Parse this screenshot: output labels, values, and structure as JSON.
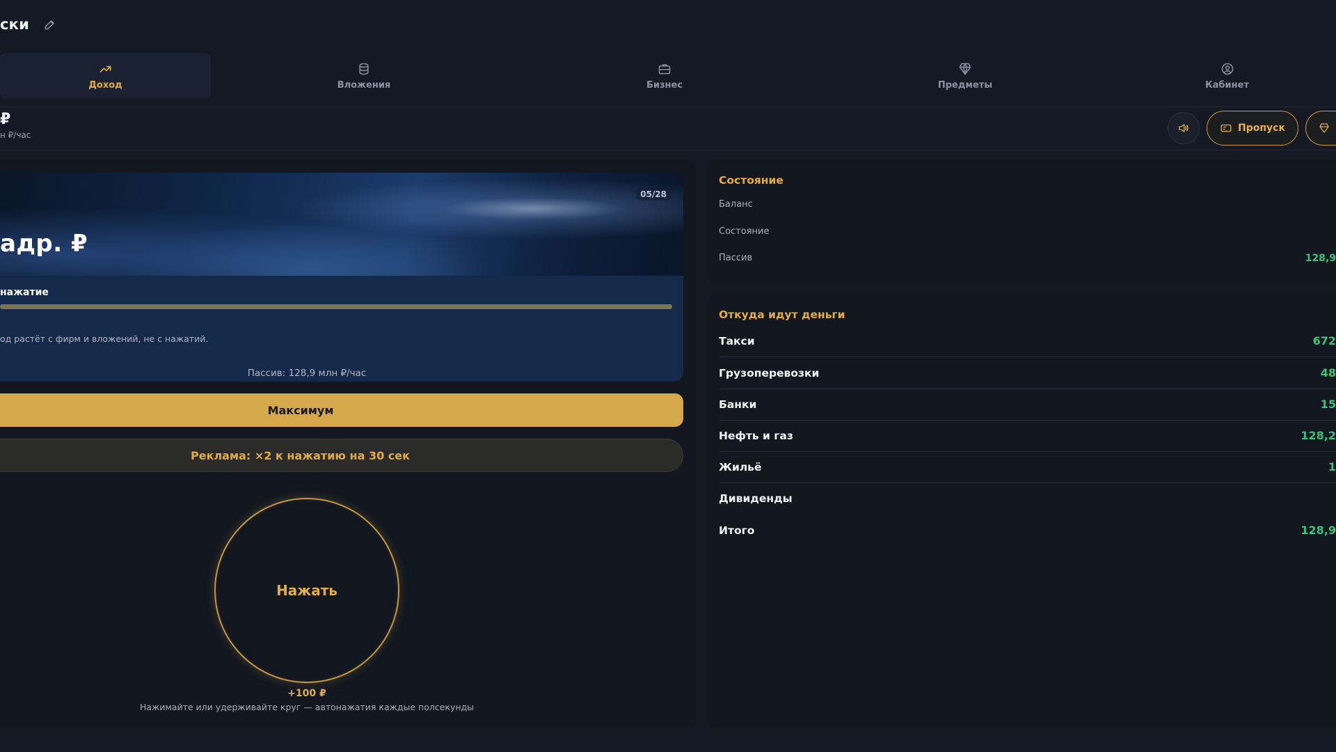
{
  "header": {
    "title": "ски"
  },
  "tabs": [
    {
      "label": "Доход",
      "icon": "trend-up-icon",
      "active": true
    },
    {
      "label": "Вложения",
      "icon": "database-icon",
      "active": false
    },
    {
      "label": "Бизнес",
      "icon": "briefcase-icon",
      "active": false
    },
    {
      "label": "Предметы",
      "icon": "gem-icon",
      "active": false
    },
    {
      "label": "Кабинет",
      "icon": "user-circle-icon",
      "active": false
    }
  ],
  "balance": {
    "symbol": "₽",
    "rate": "н ₽/час"
  },
  "actions": {
    "pass_label": "Пропуск"
  },
  "banner": {
    "counter": "05/28",
    "amount": "адр. ₽",
    "click_label": "нажатие",
    "progress_percent": 100,
    "note": "од растёт с фирм и вложений, не с нажатий."
  },
  "passive_line": "Пассив: 128,9 млн ₽/час",
  "max_button": "Максимум",
  "ad_button": "Реклама: ×2 к нажатию на 30 сек",
  "tap": {
    "label": "Нажать",
    "reward": "+100 ₽",
    "hint": "Нажимайте или удерживайте круг — автонажатия каждые полсекунды"
  },
  "state_card": {
    "title": "Состояние",
    "rows": [
      {
        "label": "Баланс",
        "value": ""
      },
      {
        "label": "Состояние",
        "value": ""
      },
      {
        "label": "Пассив",
        "value": "128,9"
      }
    ]
  },
  "income_card": {
    "title": "Откуда идут деньги",
    "rows": [
      {
        "label": "Такси",
        "value": "672"
      },
      {
        "label": "Грузоперевозки",
        "value": "48"
      },
      {
        "label": "Банки",
        "value": "15"
      },
      {
        "label": "Нефть и газ",
        "value": "128,2"
      },
      {
        "label": "Жильё",
        "value": "1"
      },
      {
        "label": "Дивиденды",
        "value": ""
      },
      {
        "label": "Итого",
        "value": "128,9"
      }
    ]
  },
  "colors": {
    "accent": "#e2ad43",
    "positive": "#39c477",
    "background": "#141923",
    "panel": "#121720"
  }
}
